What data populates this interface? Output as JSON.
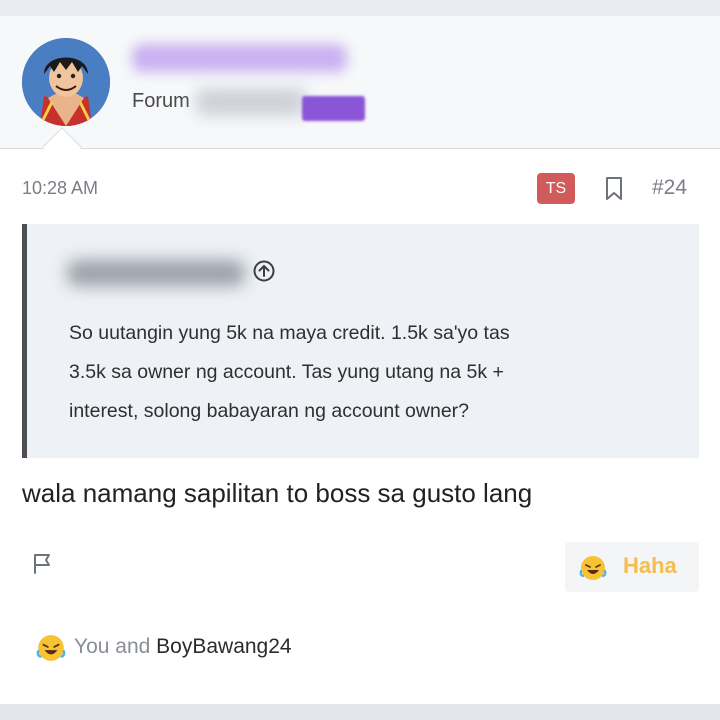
{
  "user": {
    "title_prefix": "Forum",
    "avatar": "anime-avatar"
  },
  "post": {
    "time": "10:28 AM",
    "ts_badge": "TS",
    "number": "#24",
    "quote": {
      "lines": [
        "So uutangin yung 5k na maya credit. 1.5k sa'yo tas",
        "3.5k sa owner ng account. Tas yung utang na 5k +",
        "interest, solong babayaran ng account owner?"
      ]
    },
    "message": "wala namang sapilitan to boss sa gusto lang",
    "reaction_label": "Haha",
    "reactions_summary": {
      "you_and": "You and",
      "user": "BoyBawang24"
    }
  },
  "icons": {
    "bookmark": "bookmark-icon",
    "flag": "flag-icon",
    "arrow_up": "arrow-up-circle-icon",
    "laugh": "rolling-laughing-emoji"
  },
  "colors": {
    "ts_badge": "#d15b5b",
    "elite_badge": "#8b55d8",
    "reaction_label": "#f4bd4d",
    "quote_border": "#4b4e52",
    "quote_bg": "#eef2f7"
  }
}
